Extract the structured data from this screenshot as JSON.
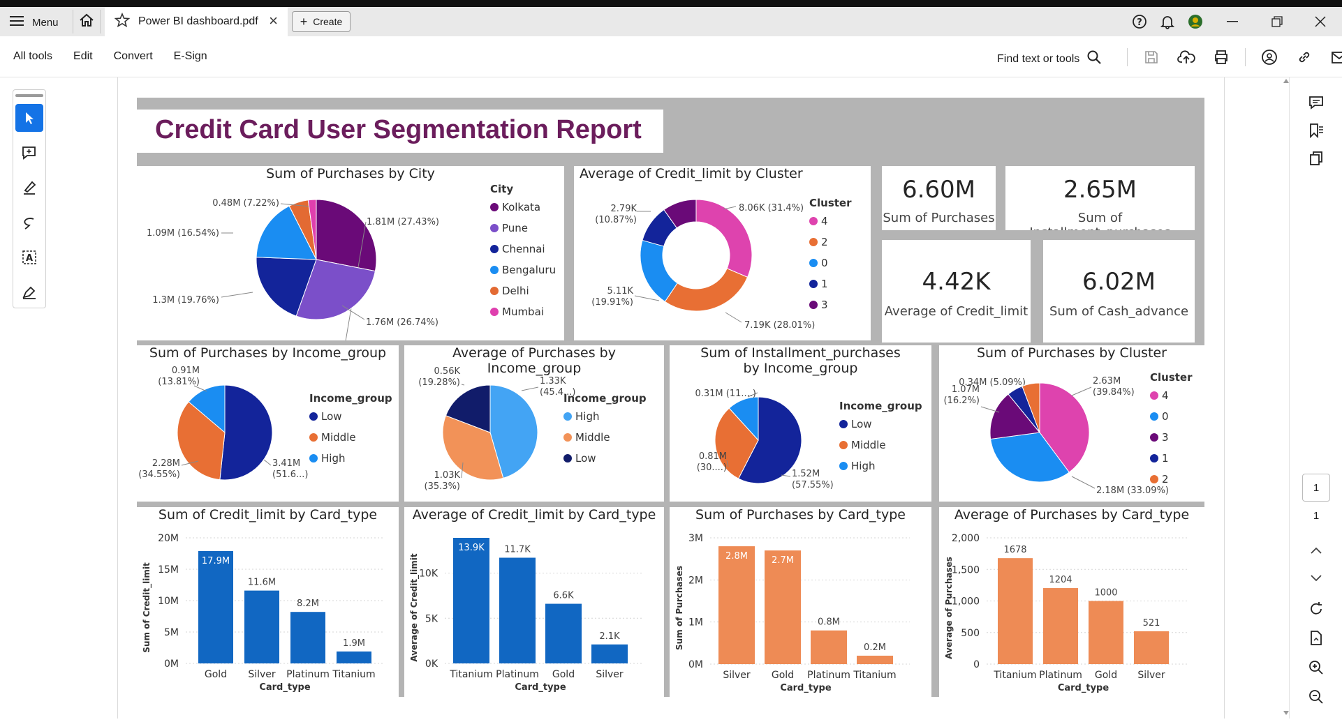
{
  "window": {
    "menu_label": "Menu",
    "tab_title": "Power BI dashboard.pdf",
    "create_label": "Create"
  },
  "toolbar": {
    "menus": [
      "All tools",
      "Edit",
      "Convert",
      "E-Sign"
    ],
    "find_label": "Find text or tools"
  },
  "pager": {
    "current": "1",
    "total": "1"
  },
  "report": {
    "title": "Credit Card User Segmentation Report"
  },
  "kpis": [
    {
      "value": "6.60M",
      "label": "Sum of Purchases"
    },
    {
      "value": "2.65M",
      "label": "Sum of Installment_purchases"
    },
    {
      "value": "4.42K",
      "label": "Average of Credit_limit"
    },
    {
      "value": "6.02M",
      "label": "Sum of Cash_advance"
    }
  ],
  "colors": {
    "report_title": "#6b1d5c",
    "bar_blue": "#1167c2",
    "bar_orange": "#ee8b55"
  },
  "chart_data": [
    {
      "id": "pie-city",
      "type": "pie",
      "title": "Sum of Purchases by City",
      "legend_title": "City",
      "slices": [
        {
          "label": "Kolkata",
          "value": 1.81,
          "data_label": "1.81M (27.43%)",
          "color": "#6a0a78"
        },
        {
          "label": "Pune",
          "value": 1.76,
          "data_label": "1.76M (26.74%)",
          "color": "#7b4fc9"
        },
        {
          "label": "Chennai",
          "value": 1.3,
          "data_label": "1.3M (19.76%)",
          "color": "#13249a"
        },
        {
          "label": "Bengaluru",
          "value": 1.09,
          "data_label": "1.09M (16.54%)",
          "color": "#1a8df2"
        },
        {
          "label": "Delhi",
          "value": 0.34,
          "data_label": "0.48M (7.22%)",
          "color": "#e36a33"
        },
        {
          "label": "Mumbai",
          "value": 0.14,
          "data_label": "",
          "color": "#df3fae"
        }
      ]
    },
    {
      "id": "donut-cluster",
      "type": "pie",
      "donut": true,
      "title": "Average of Credit_limit by Cluster",
      "legend_title": "Cluster",
      "slices": [
        {
          "label": "4",
          "value": 8.06,
          "data_label": "8.06K (31.4%)",
          "color": "#de43ae"
        },
        {
          "label": "2",
          "value": 7.19,
          "data_label": "7.19K (28.01%)",
          "color": "#e86f34"
        },
        {
          "label": "0",
          "value": 5.11,
          "data_label": "5.11K|(19.91%)",
          "color": "#1a8df2"
        },
        {
          "label": "1",
          "value": 2.79,
          "data_label": "2.79K|(10.87%)",
          "color": "#13249a"
        },
        {
          "label": "3",
          "value": 2.51,
          "data_label": "",
          "color": "#6a0a78"
        }
      ]
    },
    {
      "id": "pie-income-sum",
      "type": "pie",
      "title": "Sum of Purchases by Income_group",
      "legend_title": "Income_group",
      "slices": [
        {
          "label": "Low",
          "value": 3.41,
          "data_label": "3.41M|(51.6...)",
          "color": "#13249a"
        },
        {
          "label": "Middle",
          "value": 2.28,
          "data_label": "2.28M|(34.55%)",
          "color": "#e86f34"
        },
        {
          "label": "High",
          "value": 0.91,
          "data_label": "0.91M|(13.81%)",
          "color": "#1a8df2"
        }
      ]
    },
    {
      "id": "pie-income-avg",
      "type": "pie",
      "title": "Average of Purchases by Income_group",
      "legend_title": "Income_group",
      "slices": [
        {
          "label": "High",
          "value": 1.33,
          "data_label": "1.33K|(45.4...)",
          "color": "#43a4f4"
        },
        {
          "label": "Middle",
          "value": 1.03,
          "data_label": "1.03K|(35.3%)",
          "color": "#f29258"
        },
        {
          "label": "Low",
          "value": 0.56,
          "data_label": "0.56K|(19.28%)",
          "color": "#111c6a"
        }
      ]
    },
    {
      "id": "pie-income-inst",
      "type": "pie",
      "title": "Sum of Installment_purchases by Income_group",
      "legend_title": "Income_group",
      "slices": [
        {
          "label": "Low",
          "value": 1.52,
          "data_label": "1.52M|(57.55%)",
          "color": "#13249a"
        },
        {
          "label": "Middle",
          "value": 0.81,
          "data_label": "0.81M|(30....)",
          "color": "#e86f34"
        },
        {
          "label": "High",
          "value": 0.31,
          "data_label": "0.31M (11....)",
          "color": "#1a8df2"
        }
      ]
    },
    {
      "id": "pie-cluster-sum",
      "type": "pie",
      "title": "Sum of Purchases by Cluster",
      "legend_title": "Cluster",
      "slices": [
        {
          "label": "4",
          "value": 2.63,
          "data_label": "2.63M|(39.84%)",
          "color": "#de43ae"
        },
        {
          "label": "0",
          "value": 2.18,
          "data_label": "2.18M (33.09%)",
          "color": "#1a8df2"
        },
        {
          "label": "3",
          "value": 1.07,
          "data_label": "1.07M|(16.2%)",
          "color": "#6a0a78"
        },
        {
          "label": "1",
          "value": 0.34,
          "data_label": "0.34M (5.09%)",
          "color": "#13249a"
        },
        {
          "label": "2",
          "value": 0.38,
          "data_label": "",
          "color": "#e86f34"
        }
      ]
    },
    {
      "id": "bar-cl-sum",
      "type": "bar",
      "title": "Sum of Credit_limit by Card_type",
      "xlabel": "Card_type",
      "ylabel": "Sum of Credit_limit",
      "categories": [
        "Gold",
        "Silver",
        "Platinum",
        "Titanium"
      ],
      "values": [
        17.9,
        11.6,
        8.2,
        1.9
      ],
      "data_labels": [
        "17.9M",
        "11.6M",
        "8.2M",
        "1.9M"
      ],
      "ylim": [
        0,
        20
      ],
      "ticks": [
        0,
        5,
        10,
        15,
        20
      ],
      "tick_labels": [
        "0M",
        "5M",
        "10M",
        "15M",
        "20M"
      ],
      "color": "#1167c2",
      "inside_first": true
    },
    {
      "id": "bar-cl-avg",
      "type": "bar",
      "title": "Average of Credit_limit by Card_type",
      "xlabel": "Card_type",
      "ylabel": "Average of Credit_limit",
      "categories": [
        "Titanium",
        "Platinum",
        "Gold",
        "Silver"
      ],
      "values": [
        13.9,
        11.7,
        6.6,
        2.1
      ],
      "data_labels": [
        "13.9K",
        "11.7K",
        "6.6K",
        "2.1K"
      ],
      "ylim": [
        0,
        13.9
      ],
      "ticks": [
        0,
        5,
        10
      ],
      "tick_labels": [
        "0K",
        "5K",
        "10K"
      ],
      "color": "#1167c2",
      "inside_first": true
    },
    {
      "id": "bar-p-sum",
      "type": "bar",
      "title": "Sum of Purchases by Card_type",
      "xlabel": "Card_type",
      "ylabel": "Sum of Purchases",
      "categories": [
        "Silver",
        "Gold",
        "Platinum",
        "Titanium"
      ],
      "values": [
        2.8,
        2.7,
        0.8,
        0.2
      ],
      "data_labels": [
        "2.8M",
        "2.7M",
        "0.8M",
        "0.2M"
      ],
      "ylim": [
        0,
        3
      ],
      "ticks": [
        0,
        1,
        2,
        3
      ],
      "tick_labels": [
        "0M",
        "1M",
        "2M",
        "3M"
      ],
      "color": "#ee8b55",
      "inside_first": true,
      "inside_second": true
    },
    {
      "id": "bar-p-avg",
      "type": "bar",
      "title": "Average of Purchases by Card_type",
      "xlabel": "Card_type",
      "ylabel": "Average of Purchases",
      "categories": [
        "Titanium",
        "Platinum",
        "Gold",
        "Silver"
      ],
      "values": [
        1678,
        1204,
        1000,
        521
      ],
      "data_labels": [
        "1678",
        "1204",
        "1000",
        "521"
      ],
      "ylim": [
        0,
        2000
      ],
      "ticks": [
        0,
        500,
        1000,
        1500,
        2000
      ],
      "tick_labels": [
        "0",
        "500",
        "1,000",
        "1,500",
        "2,000"
      ],
      "color": "#ee8b55"
    }
  ]
}
